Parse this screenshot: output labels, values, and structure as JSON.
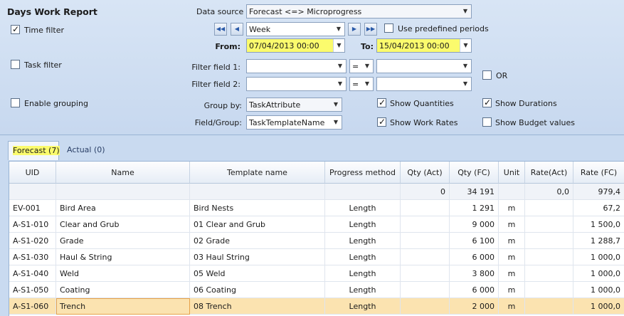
{
  "title": "Days Work Report",
  "filters": {
    "time_filter": {
      "label": "Time filter",
      "checked": true
    },
    "task_filter": {
      "label": "Task filter",
      "checked": false
    },
    "enable_grouping": {
      "label": "Enable grouping",
      "checked": false
    }
  },
  "data_source": {
    "label": "Data source",
    "value": "Forecast <=> Microprogress"
  },
  "period": {
    "value": "Week",
    "use_predefined": {
      "label": "Use predefined periods",
      "checked": false
    }
  },
  "from": {
    "label": "From:",
    "value": "07/04/2013 00:00"
  },
  "to": {
    "label": "To:",
    "value": "15/04/2013 00:00"
  },
  "filter_field_1": {
    "label": "Filter field 1:",
    "op": "="
  },
  "filter_field_2": {
    "label": "Filter field 2:",
    "op": "="
  },
  "or_option": {
    "label": "OR",
    "checked": false
  },
  "group_by": {
    "label": "Group by:",
    "value": "TaskAttribute"
  },
  "field_group": {
    "label": "Field/Group:",
    "value": "TaskTemplateName"
  },
  "options": {
    "show_quantities": {
      "label": "Show Quantities",
      "checked": true
    },
    "show_durations": {
      "label": "Show Durations",
      "checked": true
    },
    "show_work_rates": {
      "label": "Show Work Rates",
      "checked": true
    },
    "show_budget_values": {
      "label": "Show Budget values",
      "checked": false
    }
  },
  "tabs": [
    {
      "label": "Forecast (7)",
      "active": true
    },
    {
      "label": "Actual (0)",
      "active": false
    }
  ],
  "columns": [
    "UID",
    "Name",
    "Template name",
    "Progress method",
    "Qty (Act)",
    "Qty (FC)",
    "Unit",
    "Rate(Act)",
    "Rate (FC)"
  ],
  "summary": {
    "qty_act": "0",
    "qty_fc": "34 191",
    "rate_act": "0,0",
    "rate_fc": "979,4"
  },
  "rows": [
    {
      "uid": "EV-001",
      "name": "Bird Area",
      "template": "Bird Nests",
      "method": "Length",
      "qty_act": "",
      "qty_fc": "1 291",
      "unit": "m",
      "rate_act": "",
      "rate_fc": "67,2"
    },
    {
      "uid": "A-S1-010",
      "name": "Clear and Grub",
      "template": "01 Clear and Grub",
      "method": "Length",
      "qty_act": "",
      "qty_fc": "9 000",
      "unit": "m",
      "rate_act": "",
      "rate_fc": "1 500,0"
    },
    {
      "uid": "A-S1-020",
      "name": "Grade",
      "template": "02 Grade",
      "method": "Length",
      "qty_act": "",
      "qty_fc": "6 100",
      "unit": "m",
      "rate_act": "",
      "rate_fc": "1 288,7"
    },
    {
      "uid": "A-S1-030",
      "name": "Haul & String",
      "template": "03 Haul String",
      "method": "Length",
      "qty_act": "",
      "qty_fc": "6 000",
      "unit": "m",
      "rate_act": "",
      "rate_fc": "1 000,0"
    },
    {
      "uid": "A-S1-040",
      "name": "Weld",
      "template": "05 Weld",
      "method": "Length",
      "qty_act": "",
      "qty_fc": "3 800",
      "unit": "m",
      "rate_act": "",
      "rate_fc": "1 000,0"
    },
    {
      "uid": "A-S1-050",
      "name": "Coating",
      "template": "06 Coating",
      "method": "Length",
      "qty_act": "",
      "qty_fc": "6 000",
      "unit": "m",
      "rate_act": "",
      "rate_fc": "1 000,0"
    },
    {
      "uid": "A-S1-060",
      "name": "Trench",
      "template": "08 Trench",
      "method": "Length",
      "qty_act": "",
      "qty_fc": "2 000",
      "unit": "m",
      "rate_act": "",
      "rate_fc": "1 000,0"
    }
  ],
  "selected_row": 6,
  "colors": {
    "highlight": "#fbfb6d",
    "selection": "#fbe3b0",
    "panel": "#c9daf0"
  }
}
